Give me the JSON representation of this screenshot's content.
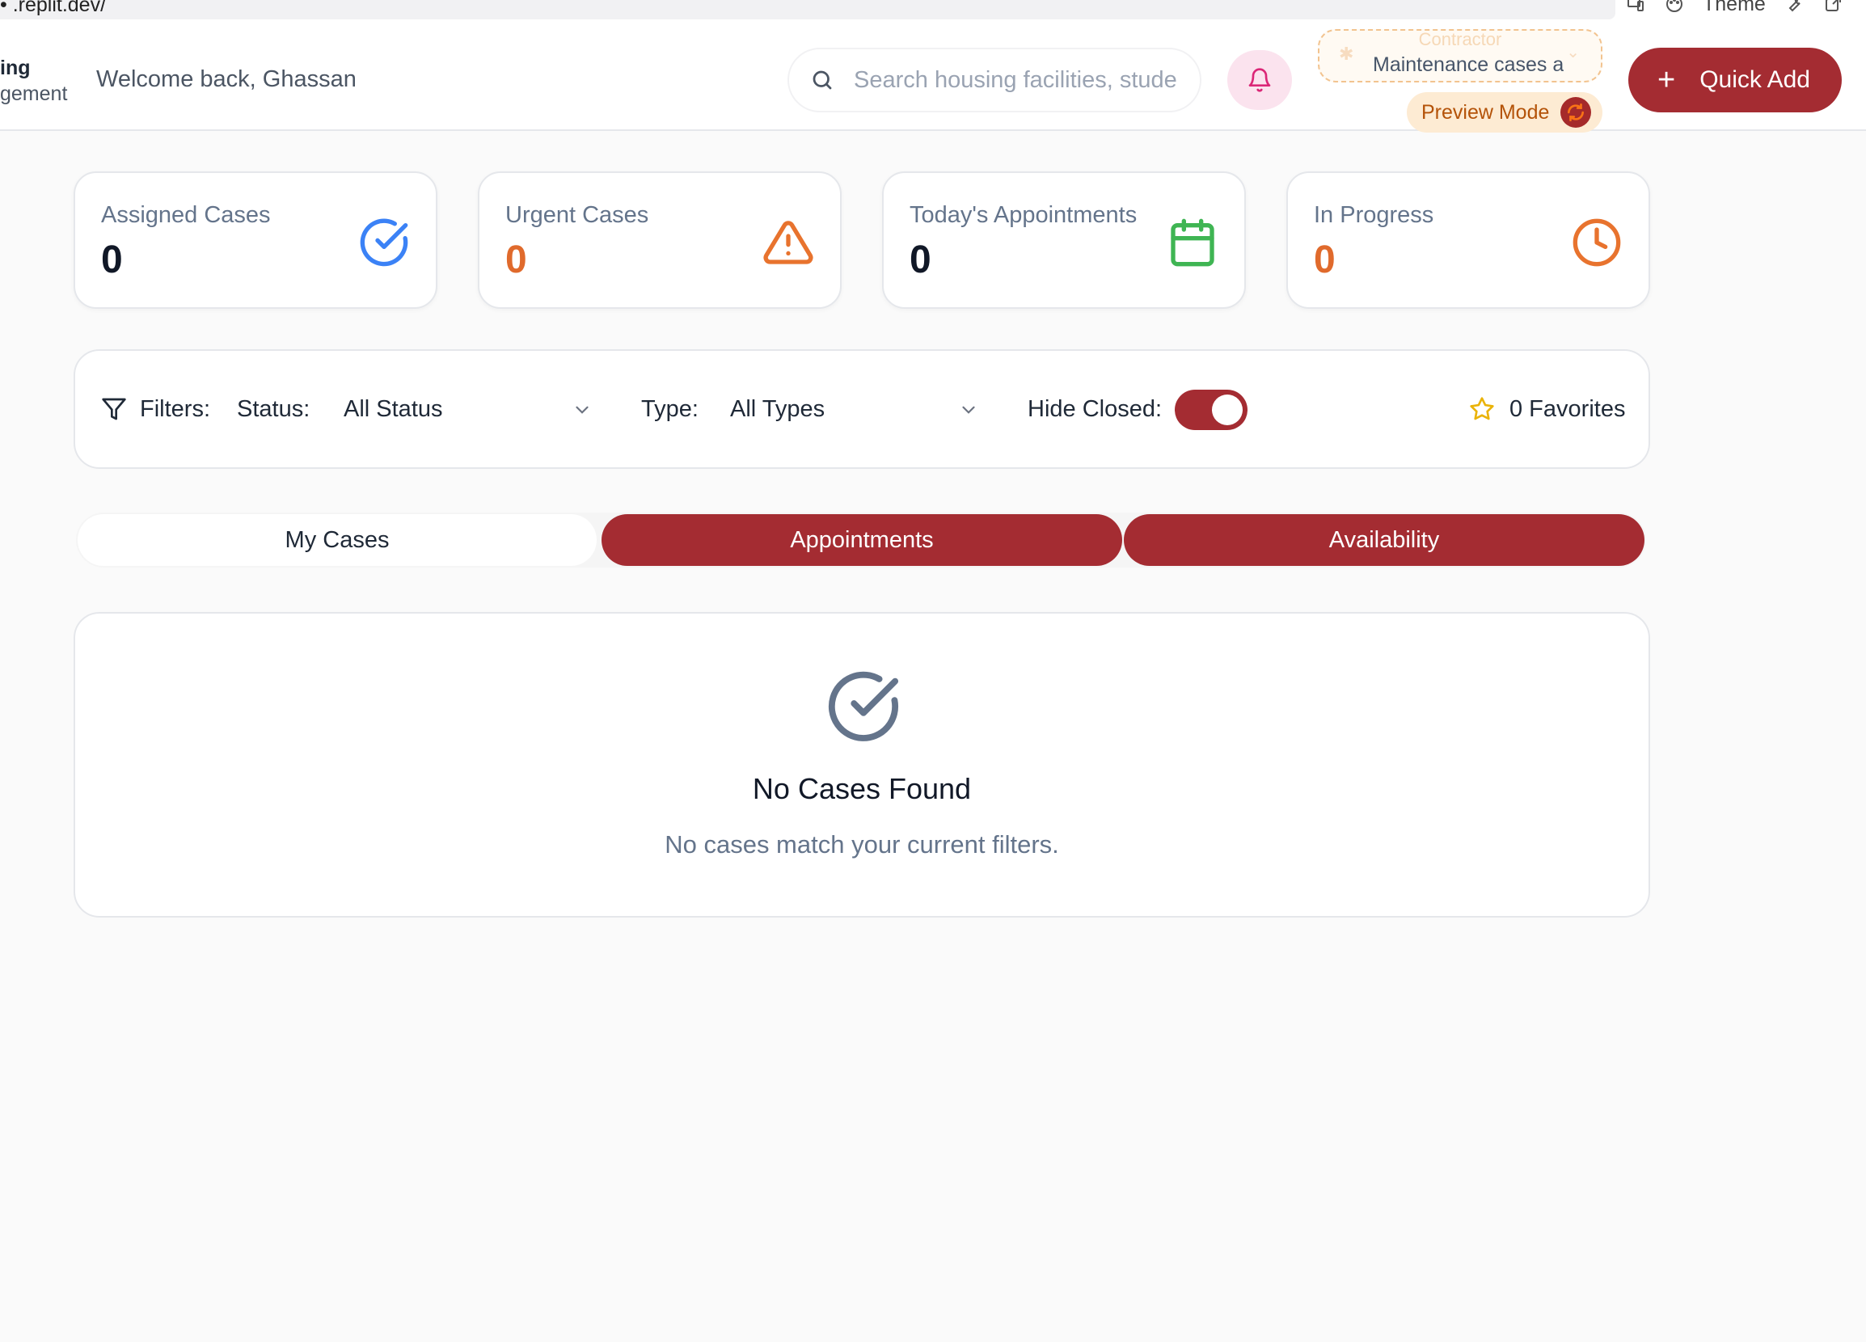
{
  "browser": {
    "url": "• .replit.dev/",
    "theme_label": "Theme"
  },
  "header": {
    "brand_line1": "ing",
    "brand_line2": "gement",
    "welcome": "Welcome back, Ghassan",
    "search_placeholder": "Search housing facilities, stude",
    "role_label": "Contractor",
    "role_description": "Maintenance cases a",
    "preview_mode": "Preview Mode",
    "quick_add": "Quick Add"
  },
  "stats": [
    {
      "label": "Assigned Cases",
      "value": "0",
      "color": "#111827",
      "icon": "check-circle-icon",
      "icon_color": "#3b82f6"
    },
    {
      "label": "Urgent Cases",
      "value": "0",
      "color": "#e06a2c",
      "icon": "warning-triangle-icon",
      "icon_color": "#e8732e"
    },
    {
      "label": "Today's Appointments",
      "value": "0",
      "color": "#111827",
      "icon": "calendar-icon",
      "icon_color": "#3fb553"
    },
    {
      "label": "In Progress",
      "value": "0",
      "color": "#e06a2c",
      "icon": "clock-icon",
      "icon_color": "#e8732e"
    }
  ],
  "filters": {
    "title": "Filters:",
    "status_label": "Status:",
    "status_value": "All Status",
    "type_label": "Type:",
    "type_value": "All Types",
    "hide_closed_label": "Hide Closed:",
    "hide_closed": true,
    "favorites": "0 Favorites"
  },
  "tabs": [
    {
      "label": "My Cases",
      "active": true
    },
    {
      "label": "Appointments",
      "active": false
    },
    {
      "label": "Availability",
      "active": false
    }
  ],
  "empty_state": {
    "title": "No Cases Found",
    "subtitle": "No cases match your current filters."
  },
  "colors": {
    "brand": "#a42c32",
    "accent_orange": "#e8732e"
  }
}
